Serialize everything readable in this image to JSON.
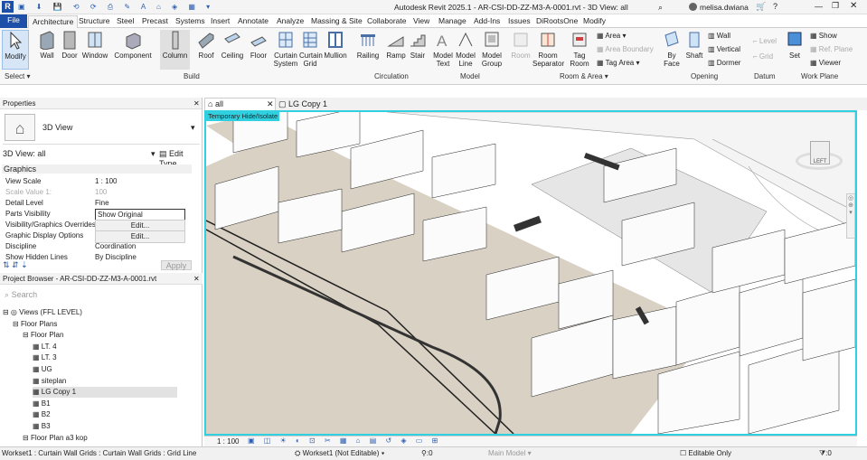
{
  "title": "Autodesk Revit 2025.1 - AR-CSI-DD-ZZ-M3-A-0001.rvt - 3D View: all",
  "user": "melisa.dwiana",
  "tabs": [
    "File",
    "Architecture",
    "Structure",
    "Steel",
    "Precast",
    "Systems",
    "Insert",
    "Annotate",
    "Analyze",
    "Massing & Site",
    "Collaborate",
    "View",
    "Manage",
    "Add-Ins",
    "Issues",
    "DiRootsOne",
    "Modify"
  ],
  "tools": {
    "modify": "Modify",
    "wall": "Wall",
    "door": "Door",
    "window": "Window",
    "component": "Component",
    "column": "Column",
    "roof": "Roof",
    "ceiling": "Ceiling",
    "floor": "Floor",
    "curtain_system": "Curtain System",
    "curtain_grid": "Curtain Grid",
    "mullion": "Mullion",
    "railing": "Railing",
    "ramp": "Ramp",
    "stair": "Stair",
    "model_text": "Model Text",
    "model_line": "Model Line",
    "model_group": "Model Group",
    "room": "Room",
    "room_separator": "Room Separator",
    "tag_room": "Tag Room",
    "area": "Area",
    "area_boundary": "Area Boundary",
    "tag_area": "Tag",
    "area2": "Area",
    "by_face": "By Face",
    "shaft": "Shaft",
    "wall2": "Wall",
    "vertical": "Vertical",
    "dormer": "Dormer",
    "level": "Level",
    "grid": "Grid",
    "set": "Set",
    "show": "Show",
    "ref_plane": "Ref. Plane",
    "viewer": "Viewer"
  },
  "panels": {
    "select": "Select",
    "build": "Build",
    "circulation": "Circulation",
    "model": "Model",
    "room_area": "Room & Area",
    "opening": "Opening",
    "datum": "Datum",
    "work_plane": "Work Plane"
  },
  "properties": {
    "header": "Properties",
    "type": "3D View",
    "selector": "3D View: all",
    "edit_type": "Edit Type",
    "group": "Graphics",
    "rows": [
      {
        "k": "View Scale",
        "v": "1 : 100"
      },
      {
        "k": "Scale Value    1:",
        "v": "100"
      },
      {
        "k": "Detail Level",
        "v": "Fine"
      },
      {
        "k": "Parts Visibility",
        "v": "Show Original"
      },
      {
        "k": "Visibility/Graphics Overrides",
        "v": "Edit..."
      },
      {
        "k": "Graphic Display Options",
        "v": "Edit..."
      },
      {
        "k": "Discipline",
        "v": "Coordination"
      },
      {
        "k": "Show Hidden Lines",
        "v": "By Discipline"
      }
    ],
    "apply": "Apply"
  },
  "browser": {
    "header": "Project Browser - AR-CSI-DD-ZZ-M3-A-0001.rvt",
    "search": "Search",
    "items": [
      "Views (FFL LEVEL)",
      "Floor Plans",
      "Floor Plan",
      "LT. 4",
      "LT. 3",
      "UG",
      "siteplan",
      "LG Copy 1",
      "B1",
      "B2",
      "B3",
      "Floor Plan a3 kop"
    ]
  },
  "viewtabs": [
    "all",
    "LG Copy 1"
  ],
  "temp_hide": "Temporary Hide/Isolate",
  "viewcube": "LEFT",
  "scale": "1 : 100",
  "status": {
    "left": "Workset1 : Curtain Wall Grids : Curtain Wall Grids : Grid Line",
    "workset": "Workset1 (Not Editable)",
    "zero": ":0",
    "main_model": "Main Model",
    "editable": "Editable Only",
    "filter": ":0"
  }
}
